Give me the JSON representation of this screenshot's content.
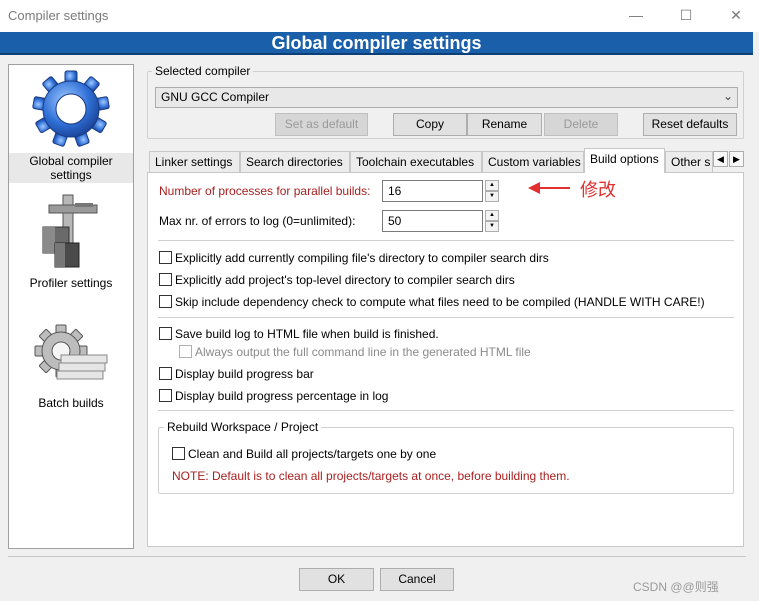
{
  "window": {
    "title": "Compiler settings",
    "minimize_glyph": "—",
    "maximize_glyph": "☐",
    "close_glyph": "✕"
  },
  "header": {
    "title": "Global compiler settings"
  },
  "nav": [
    {
      "label": "Global compiler settings",
      "icon": "gear-icon",
      "selected": true
    },
    {
      "label": "Profiler settings",
      "icon": "caliper-icon",
      "selected": false
    },
    {
      "label": "Batch builds",
      "icon": "batch-gear-icon",
      "selected": false
    }
  ],
  "compiler": {
    "group_label": "Selected compiler",
    "selected": "GNU GCC Compiler",
    "buttons": {
      "set_default": "Set as default",
      "copy": "Copy",
      "rename": "Rename",
      "delete": "Delete",
      "reset": "Reset defaults"
    }
  },
  "tabs": [
    "Linker settings",
    "Search directories",
    "Toolchain executables",
    "Custom variables",
    "Build options",
    "Other s"
  ],
  "active_tab": "Build options",
  "build_options": {
    "parallel_label": "Number of processes for parallel builds:",
    "parallel_value": "16",
    "max_errors_label": "Max nr. of errors to log (0=unlimited):",
    "max_errors_value": "50",
    "checkboxes_a": [
      {
        "label": "Explicitly add currently compiling file's directory to compiler search dirs",
        "checked": false
      },
      {
        "label": "Explicitly add project's top-level directory to compiler search dirs",
        "checked": false
      },
      {
        "label": "Skip include dependency check to compute what files need to be compiled (HANDLE WITH CARE!)",
        "checked": false
      }
    ],
    "checkboxes_b": [
      {
        "label": "Save build log to HTML file when build is finished.",
        "checked": false,
        "disabled": false
      },
      {
        "label": "Always output the full command line in the generated HTML file",
        "checked": false,
        "disabled": true
      },
      {
        "label": "Display build progress bar",
        "checked": false,
        "disabled": false
      },
      {
        "label": "Display build progress percentage in log",
        "checked": false,
        "disabled": false
      }
    ],
    "rebuild_group": {
      "label": "Rebuild Workspace / Project",
      "checkbox": "Clean and Build all projects/targets one by one",
      "note": "NOTE: Default is to clean all projects/targets at once, before building them."
    }
  },
  "annotation": {
    "text": "修改",
    "color": "#e03030"
  },
  "footer": {
    "ok": "OK",
    "cancel": "Cancel"
  },
  "watermark": "CSDN @@则强",
  "colors": {
    "banner": "#1a5fa9",
    "highlight_text": "#a82020"
  }
}
